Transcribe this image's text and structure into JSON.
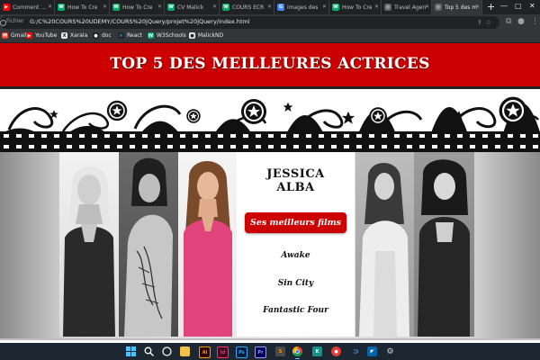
{
  "browser": {
    "tabs": [
      {
        "title": "Comment ...",
        "icon": "youtube-icon",
        "color": "#ff0000",
        "glyph": "▶"
      },
      {
        "title": "How To Cre",
        "icon": "w3schools-icon",
        "color": "#04aa6d",
        "glyph": "W"
      },
      {
        "title": "How To Cre",
        "icon": "w3schools-icon",
        "color": "#04aa6d",
        "glyph": "W"
      },
      {
        "title": "CV Malick",
        "icon": "w3schools-icon",
        "color": "#04aa6d",
        "glyph": "W"
      },
      {
        "title": "COURS ECR",
        "icon": "w3schools-icon",
        "color": "#04aa6d",
        "glyph": "W"
      },
      {
        "title": "images des",
        "icon": "google-icon",
        "color": "#4285f4",
        "glyph": "G"
      },
      {
        "title": "How To Cre",
        "icon": "w3schools-icon",
        "color": "#04aa6d",
        "glyph": "W"
      },
      {
        "title": "Travel Agen",
        "icon": "globe-icon",
        "color": "#5f6368",
        "glyph": "◎"
      },
      {
        "title": "Top 5 des m",
        "icon": "globe-icon",
        "color": "#5f6368",
        "glyph": "◎",
        "active": true
      }
    ],
    "address": {
      "scheme": "Fichier",
      "url": "G:/C%20COURS%20UDEMY/COURS%20jQuery/projet%20jQuery/index.html"
    },
    "bookmarks": [
      {
        "label": "Gmail",
        "icon": "gmail-icon",
        "color": "#ea4335",
        "glyph": "M"
      },
      {
        "label": "YouTube",
        "icon": "youtube-icon",
        "color": "#ff0000",
        "glyph": "▶"
      },
      {
        "label": "Xarala",
        "icon": "xarala-icon",
        "color": "#eeeeee",
        "glyph": "X"
      },
      {
        "label": "doc",
        "icon": "doc-icon",
        "color": "#222222",
        "glyph": "●"
      },
      {
        "label": "React",
        "icon": "react-icon",
        "color": "#1b2733",
        "glyph": "⚛"
      },
      {
        "label": "W3Schools",
        "icon": "w3schools-icon",
        "color": "#04aa6d",
        "glyph": "W"
      },
      {
        "label": "MalickND",
        "icon": "github-icon",
        "color": "#e8eaed",
        "glyph": "●"
      }
    ]
  },
  "page": {
    "banner_title": "TOP 5 DES MEILLEURES ACTRICES",
    "actress": {
      "name_line1": "JESSICA",
      "name_line2": "ALBA"
    },
    "films_button_label": "Ses meilleurs films",
    "films": [
      "Awake",
      "Sin City",
      "Fantastic Four"
    ],
    "colors": {
      "accent": "#cc0000",
      "highlight_photo": "#e0447a"
    }
  },
  "taskbar": {
    "apps": [
      {
        "name": "windows-start-icon"
      },
      {
        "name": "search-icon"
      },
      {
        "name": "task-view-icon"
      },
      {
        "name": "file-explorer-icon"
      },
      {
        "name": "illustrator-icon"
      },
      {
        "name": "indesign-icon"
      },
      {
        "name": "photoshop-icon"
      },
      {
        "name": "premiere-icon"
      },
      {
        "name": "sublime-icon"
      },
      {
        "name": "chrome-icon"
      },
      {
        "name": "gitkraken-icon"
      },
      {
        "name": "chat-icon"
      },
      {
        "name": "vscode-icon"
      },
      {
        "name": "vscode-insiders-icon"
      },
      {
        "name": "settings-icon"
      }
    ]
  }
}
